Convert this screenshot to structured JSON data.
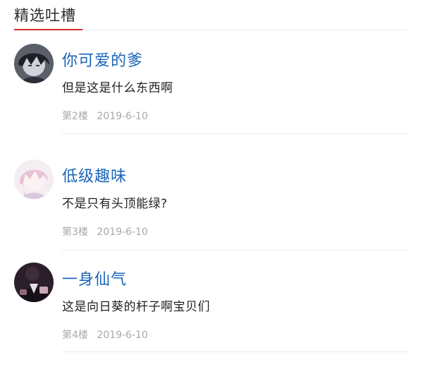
{
  "section": {
    "title": "精选吐槽",
    "accent_color": "#d62e2e"
  },
  "comments": [
    {
      "avatar_icon": "avatar-dark-hair-icon",
      "username": "你可爱的爹",
      "content": "但是这是什么东西啊",
      "floor": "第2楼",
      "date": "2019-6-10"
    },
    {
      "avatar_icon": "avatar-pink-hair-icon",
      "username": "低级趣味",
      "content": "不是只有头顶能绿?",
      "floor": "第3楼",
      "date": "2019-6-10"
    },
    {
      "avatar_icon": "avatar-suit-icon",
      "username": "一身仙气",
      "content": "这是向日葵的杆子啊宝贝们",
      "floor": "第4楼",
      "date": "2019-6-10"
    }
  ],
  "colors": {
    "username": "#1a64b8",
    "meta": "#a8a8a8",
    "divider": "#e8e8e8"
  }
}
